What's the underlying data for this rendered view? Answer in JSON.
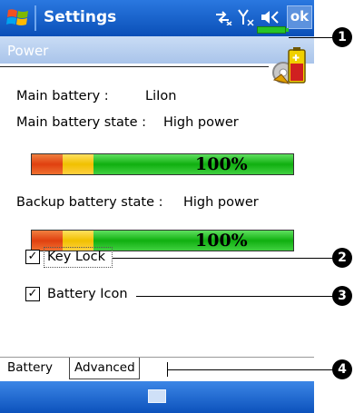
{
  "titlebar": {
    "title": "Settings",
    "status_icons": "⇄ᵗ Yₓ ◁‹",
    "ok_label": "ok"
  },
  "header": {
    "title": "Power"
  },
  "main_battery": {
    "label": "Main battery :",
    "type": "LiIon",
    "state_label": "Main battery state :",
    "state": "High power",
    "percent_text": "100%",
    "level": 1.0
  },
  "backup_battery": {
    "state_label": "Backup battery state :",
    "state": "High power",
    "percent_text": "100%",
    "level": 1.0
  },
  "options": {
    "key_lock_label": "Key Lock",
    "key_lock_checked": true,
    "battery_icon_label": "Battery Icon",
    "battery_icon_checked": true,
    "check_mark": "✓"
  },
  "tabs": [
    {
      "label": "Battery",
      "active": true
    },
    {
      "label": "Advanced",
      "active": false
    }
  ],
  "callouts": [
    "1",
    "2",
    "3",
    "4"
  ],
  "icons": {
    "windows_flag": "windows-start-icon",
    "keyboard": "keyboard-icon",
    "power_settings": "power-settings-icon"
  }
}
